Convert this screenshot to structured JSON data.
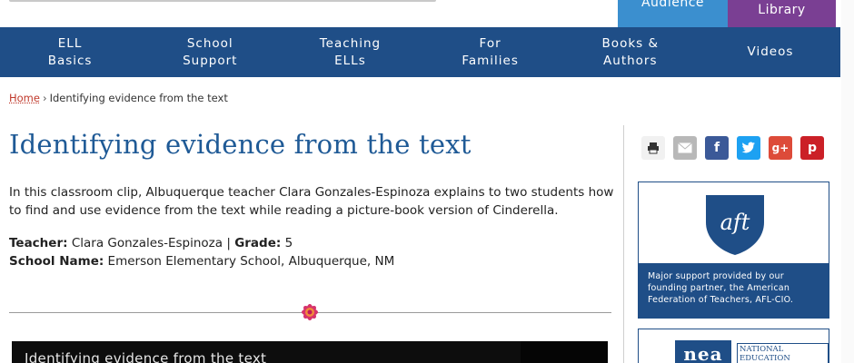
{
  "header": {
    "audience_tab": "Audience",
    "library_tab": "Library"
  },
  "nav": {
    "items": [
      {
        "label": "ELL\nBasics"
      },
      {
        "label": "School\nSupport"
      },
      {
        "label": "Teaching\nELLs"
      },
      {
        "label": "For\nFamilies"
      },
      {
        "label": "Books &\nAuthors"
      },
      {
        "label": "Videos"
      }
    ]
  },
  "breadcrumb": {
    "home": "Home",
    "separator": "›",
    "current": "Identifying evidence from the text"
  },
  "article": {
    "title": "Identifying evidence from the text",
    "intro": "In this classroom clip, Albuquerque teacher Clara Gonzales-Espinoza explains to two students how to find and use evidence from the text while reading a picture-book version of Cinderella.",
    "teacher_label": "Teacher:",
    "teacher_value": "Clara Gonzales-Espinoza",
    "meta_separator": "|",
    "grade_label": "Grade:",
    "grade_value": "5",
    "school_label": "School Name:",
    "school_value": "Emerson Elementary School, Albuquerque, NM"
  },
  "video": {
    "title": "Identifying evidence from the text"
  },
  "share": {
    "icons": [
      "print-icon",
      "email-icon",
      "facebook-icon",
      "twitter-icon",
      "google-plus-icon",
      "pinterest-icon"
    ],
    "facebook_glyph": "f",
    "google_glyph": "g+",
    "pinterest_glyph": "p"
  },
  "sidebar": {
    "aft_logo_text": "aft",
    "aft_caption": "Major support provided by our founding partner, the American Federation of Teachers, AFL-CIO.",
    "nea_logo_text": "nea",
    "nea_text": "NATIONAL EDUCATION"
  },
  "colors": {
    "nav_bg": "#1f4e87",
    "title": "#1f5a96",
    "audience_tab": "#3b8fcf",
    "library_tab": "#7a3f93",
    "breadcrumb_link": "#c0392b"
  }
}
